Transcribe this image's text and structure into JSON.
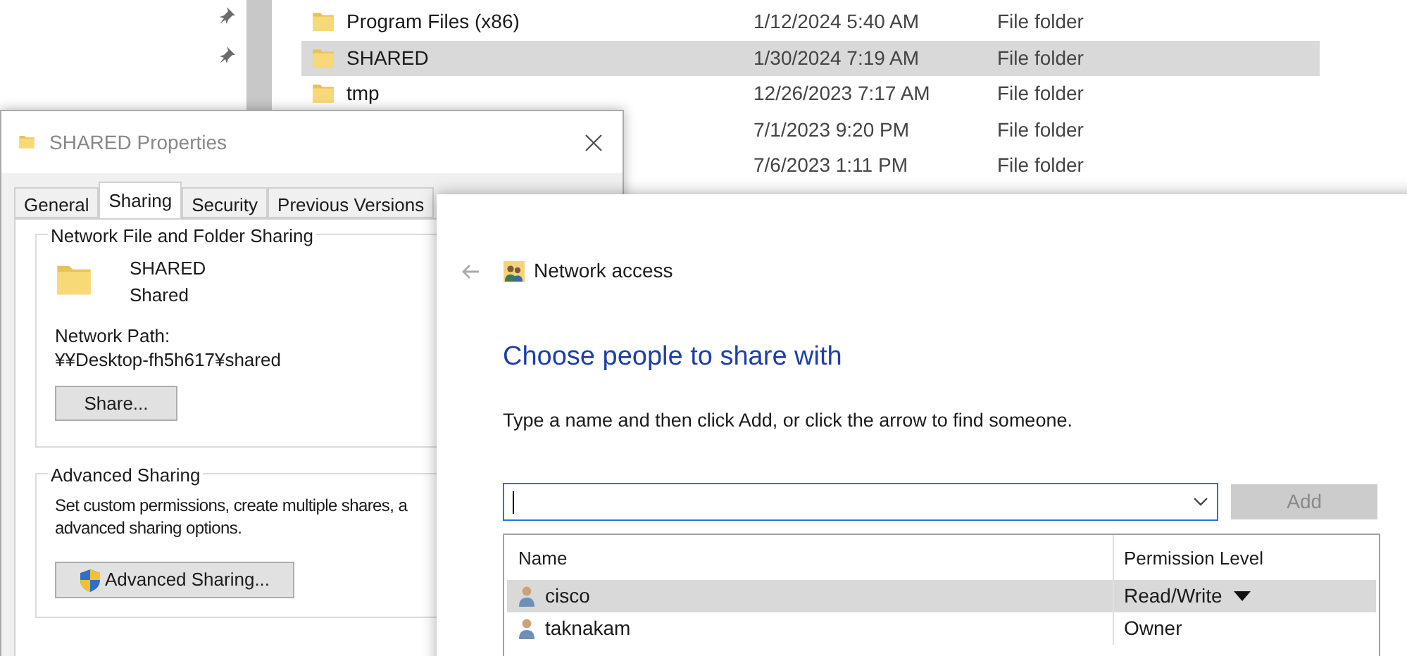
{
  "explorer": {
    "files": [
      {
        "name": "Program Files (x86)",
        "date": "1/12/2024 5:40 AM",
        "type": "File folder",
        "selected": false
      },
      {
        "name": "SHARED",
        "date": "1/30/2024 7:19 AM",
        "type": "File folder",
        "selected": true
      },
      {
        "name": "tmp",
        "date": "12/26/2023 7:17 AM",
        "type": "File folder",
        "selected": false
      },
      {
        "date": "7/1/2023 9:20 PM",
        "type": "File folder",
        "selected": false
      },
      {
        "date": "7/6/2023 1:11 PM",
        "type": "File folder",
        "selected": false
      }
    ]
  },
  "properties": {
    "title": "SHARED Properties",
    "tabs": [
      {
        "label": "General",
        "selected": false
      },
      {
        "label": "Sharing",
        "selected": true
      },
      {
        "label": "Security",
        "selected": false
      },
      {
        "label": "Previous Versions",
        "selected": false
      }
    ],
    "sharing_group": {
      "title": "Network File and Folder Sharing",
      "folder_name": "SHARED",
      "folder_status": "Shared",
      "path_label": "Network Path:",
      "path": "¥¥Desktop-fh5h617¥shared",
      "share_button": "Share..."
    },
    "advanced_group": {
      "title": "Advanced Sharing",
      "description_lines": [
        "Set custom permissions, create multiple shares, a",
        "advanced sharing options."
      ],
      "button": "Advanced Sharing..."
    }
  },
  "network_access": {
    "title": "Network access",
    "heading": "Choose people to share with",
    "instruction": "Type a name and then click Add, or click the arrow to find someone.",
    "add_button": {
      "label": "Add",
      "disabled": true
    },
    "table": {
      "columns": [
        "Name",
        "Permission Level"
      ],
      "rows": [
        {
          "name": "cisco",
          "permission": "Read/Write",
          "selected": true
        },
        {
          "name": "taknakam",
          "permission": "Owner",
          "selected": false
        }
      ]
    }
  }
}
